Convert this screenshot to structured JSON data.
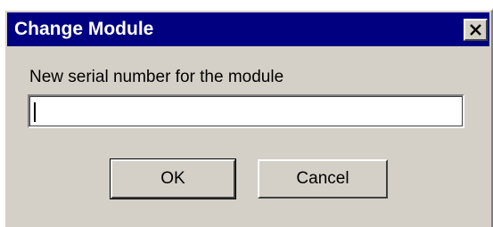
{
  "window": {
    "title": "Change Module",
    "close_icon": "close-icon"
  },
  "form": {
    "prompt": "New serial number for the module",
    "serial_value": "",
    "serial_placeholder": ""
  },
  "buttons": {
    "ok_label": "OK",
    "cancel_label": "Cancel"
  },
  "colors": {
    "titlebar": "#000080",
    "face": "#d4d0c8",
    "title_text": "#ffffff"
  }
}
